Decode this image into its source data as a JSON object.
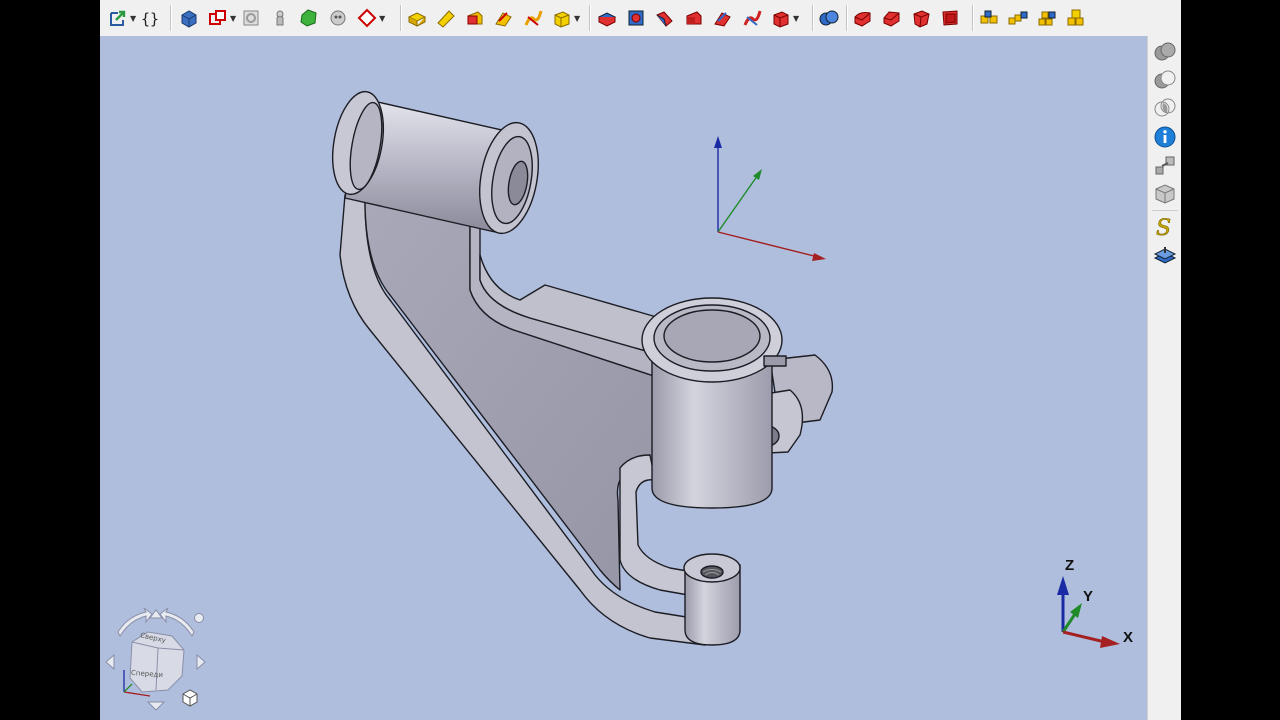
{
  "toolbar": {
    "groups": [
      {
        "name": "macro",
        "icons": [
          "macro-export-icon",
          "macro-braces-icon"
        ]
      },
      {
        "name": "part-design-basic",
        "icons": [
          "part-body-icon",
          "create-sketch-icon",
          "validate-sketch-icon",
          "shape-binder-icon",
          "subshape-binder-icon",
          "clone-icon",
          "sketch-plane-icon"
        ]
      },
      {
        "name": "additive-features",
        "icons": [
          "pad-icon",
          "revolution-icon",
          "additive-loft-icon",
          "additive-pipe-icon",
          "additive-helix-icon",
          "additive-box-icon"
        ]
      },
      {
        "name": "subtractive-features",
        "icons": [
          "pocket-icon",
          "hole-icon",
          "groove-icon",
          "subtractive-loft-icon",
          "subtractive-pipe-icon",
          "subtractive-helix-icon",
          "subtractive-box-icon"
        ]
      },
      {
        "name": "boolean",
        "icons": [
          "boolean-icon"
        ]
      },
      {
        "name": "dress-up",
        "icons": [
          "fillet-icon",
          "chamfer-icon",
          "draft-icon",
          "thickness-icon"
        ]
      },
      {
        "name": "transformation",
        "icons": [
          "mirrored-icon",
          "linear-pattern-icon",
          "polar-pattern-icon",
          "multi-transform-icon"
        ]
      }
    ]
  },
  "rightbar": {
    "icons": [
      "boolean-union-icon",
      "boolean-cut-icon",
      "boolean-intersection-icon",
      "info-icon",
      "explode-icon",
      "box-view-icon",
      "sketcher-s-icon",
      "layers-icon"
    ]
  },
  "viewport": {
    "axis_labels": {
      "x": "X",
      "y": "Y",
      "z": "Z"
    },
    "navcube": {
      "top": "Сверху",
      "front": "Спереди"
    },
    "colors": {
      "background": "#afbedc",
      "model": "#b7b7c6",
      "x_axis": "#a52020",
      "y_axis": "#1f8a2a",
      "z_axis": "#1a2aa5"
    }
  }
}
